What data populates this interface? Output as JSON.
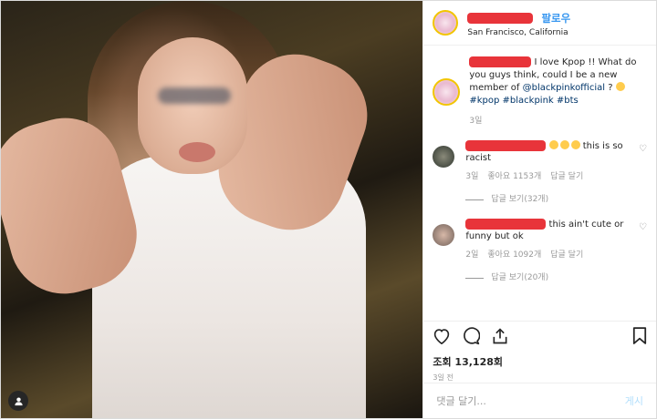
{
  "header": {
    "follow_label": "팔로우",
    "location": "San Francisco, California"
  },
  "caption": {
    "text": "I love Kpop !! What do you guys think, could I be a new member of",
    "mention": "@blackpinkofficial",
    "after": "?",
    "hashtags": "#kpop #blackpink #bts",
    "time": "3일"
  },
  "comments": [
    {
      "text": "this is so racist",
      "time": "3일",
      "likes": "좋아요 1153개",
      "reply_label": "답글 달기",
      "view_replies": "답글 보기(32개)"
    },
    {
      "text": "this ain't cute or funny but ok",
      "time": "2일",
      "likes": "좋아요 1092개",
      "reply_label": "답글 달기",
      "view_replies": "답글 보기(20개)"
    }
  ],
  "stats": {
    "views": "조회 13,128회",
    "age": "3일 전"
  },
  "add_comment": {
    "placeholder": "댓글 달기...",
    "post_label": "게시"
  },
  "colors": {
    "accent": "#3897f0",
    "redaction": "#e8343a",
    "story_ring": "#f2c500"
  },
  "icons": [
    "user-tag-icon",
    "heart-icon",
    "comment-icon",
    "share-icon",
    "bookmark-icon"
  ]
}
